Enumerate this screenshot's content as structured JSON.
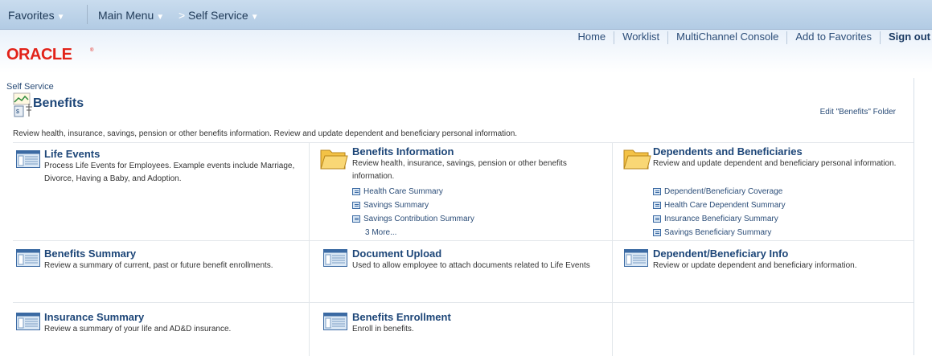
{
  "topnav": {
    "favorites": "Favorites",
    "main_menu": "Main Menu",
    "breadcrumb_arrow": ">",
    "self_service": "Self Service"
  },
  "header": {
    "logo_text": "ORACLE",
    "links": [
      "Home",
      "Worklist",
      "MultiChannel Console",
      "Add to Favorites",
      "Sign out"
    ]
  },
  "page": {
    "breadcrumb": "Self Service",
    "title": "Benefits",
    "edit_link": "Edit \"Benefits\" Folder",
    "description": "Review health, insurance, savings, pension or other benefits information. Review and update dependent and beneficiary personal information."
  },
  "items": [
    {
      "title": "Life Events",
      "desc": "Process Life Events for Employees. Example events include Marriage, Divorce, Having a Baby, and Adoption.",
      "icon": "document-list-icon"
    },
    {
      "title": "Benefits Information",
      "desc": "Review health, insurance, savings, pension or other benefits information.",
      "icon": "folder-icon",
      "links": [
        "Health Care Summary",
        "Savings Summary",
        "Savings Contribution Summary"
      ],
      "more": "3 More..."
    },
    {
      "title": "Dependents and Beneficiaries",
      "desc": "Review and update dependent and beneficiary personal information.",
      "icon": "folder-icon",
      "links": [
        "Dependent/Beneficiary Coverage",
        "Health Care Dependent Summary",
        "Insurance Beneficiary Summary",
        "Savings Beneficiary Summary"
      ]
    },
    {
      "title": "Benefits Summary",
      "desc": "Review a summary of current, past or future benefit enrollments.",
      "icon": "document-list-icon"
    },
    {
      "title": "Document Upload",
      "desc": "Used to allow employee to attach documents related to Life Events",
      "icon": "document-list-icon"
    },
    {
      "title": "Dependent/Beneficiary Info",
      "desc": "Review or update dependent and beneficiary information.",
      "icon": "document-list-icon"
    },
    {
      "title": "Insurance Summary",
      "desc": "Review a summary of your life and AD&D insurance.",
      "icon": "document-list-icon"
    },
    {
      "title": "Benefits Enrollment",
      "desc": "Enroll in benefits.",
      "icon": "document-list-icon"
    }
  ],
  "colors": {
    "nav_bg": "#c9dcee",
    "link": "#1d4678",
    "oracle_red": "#e2231a"
  }
}
